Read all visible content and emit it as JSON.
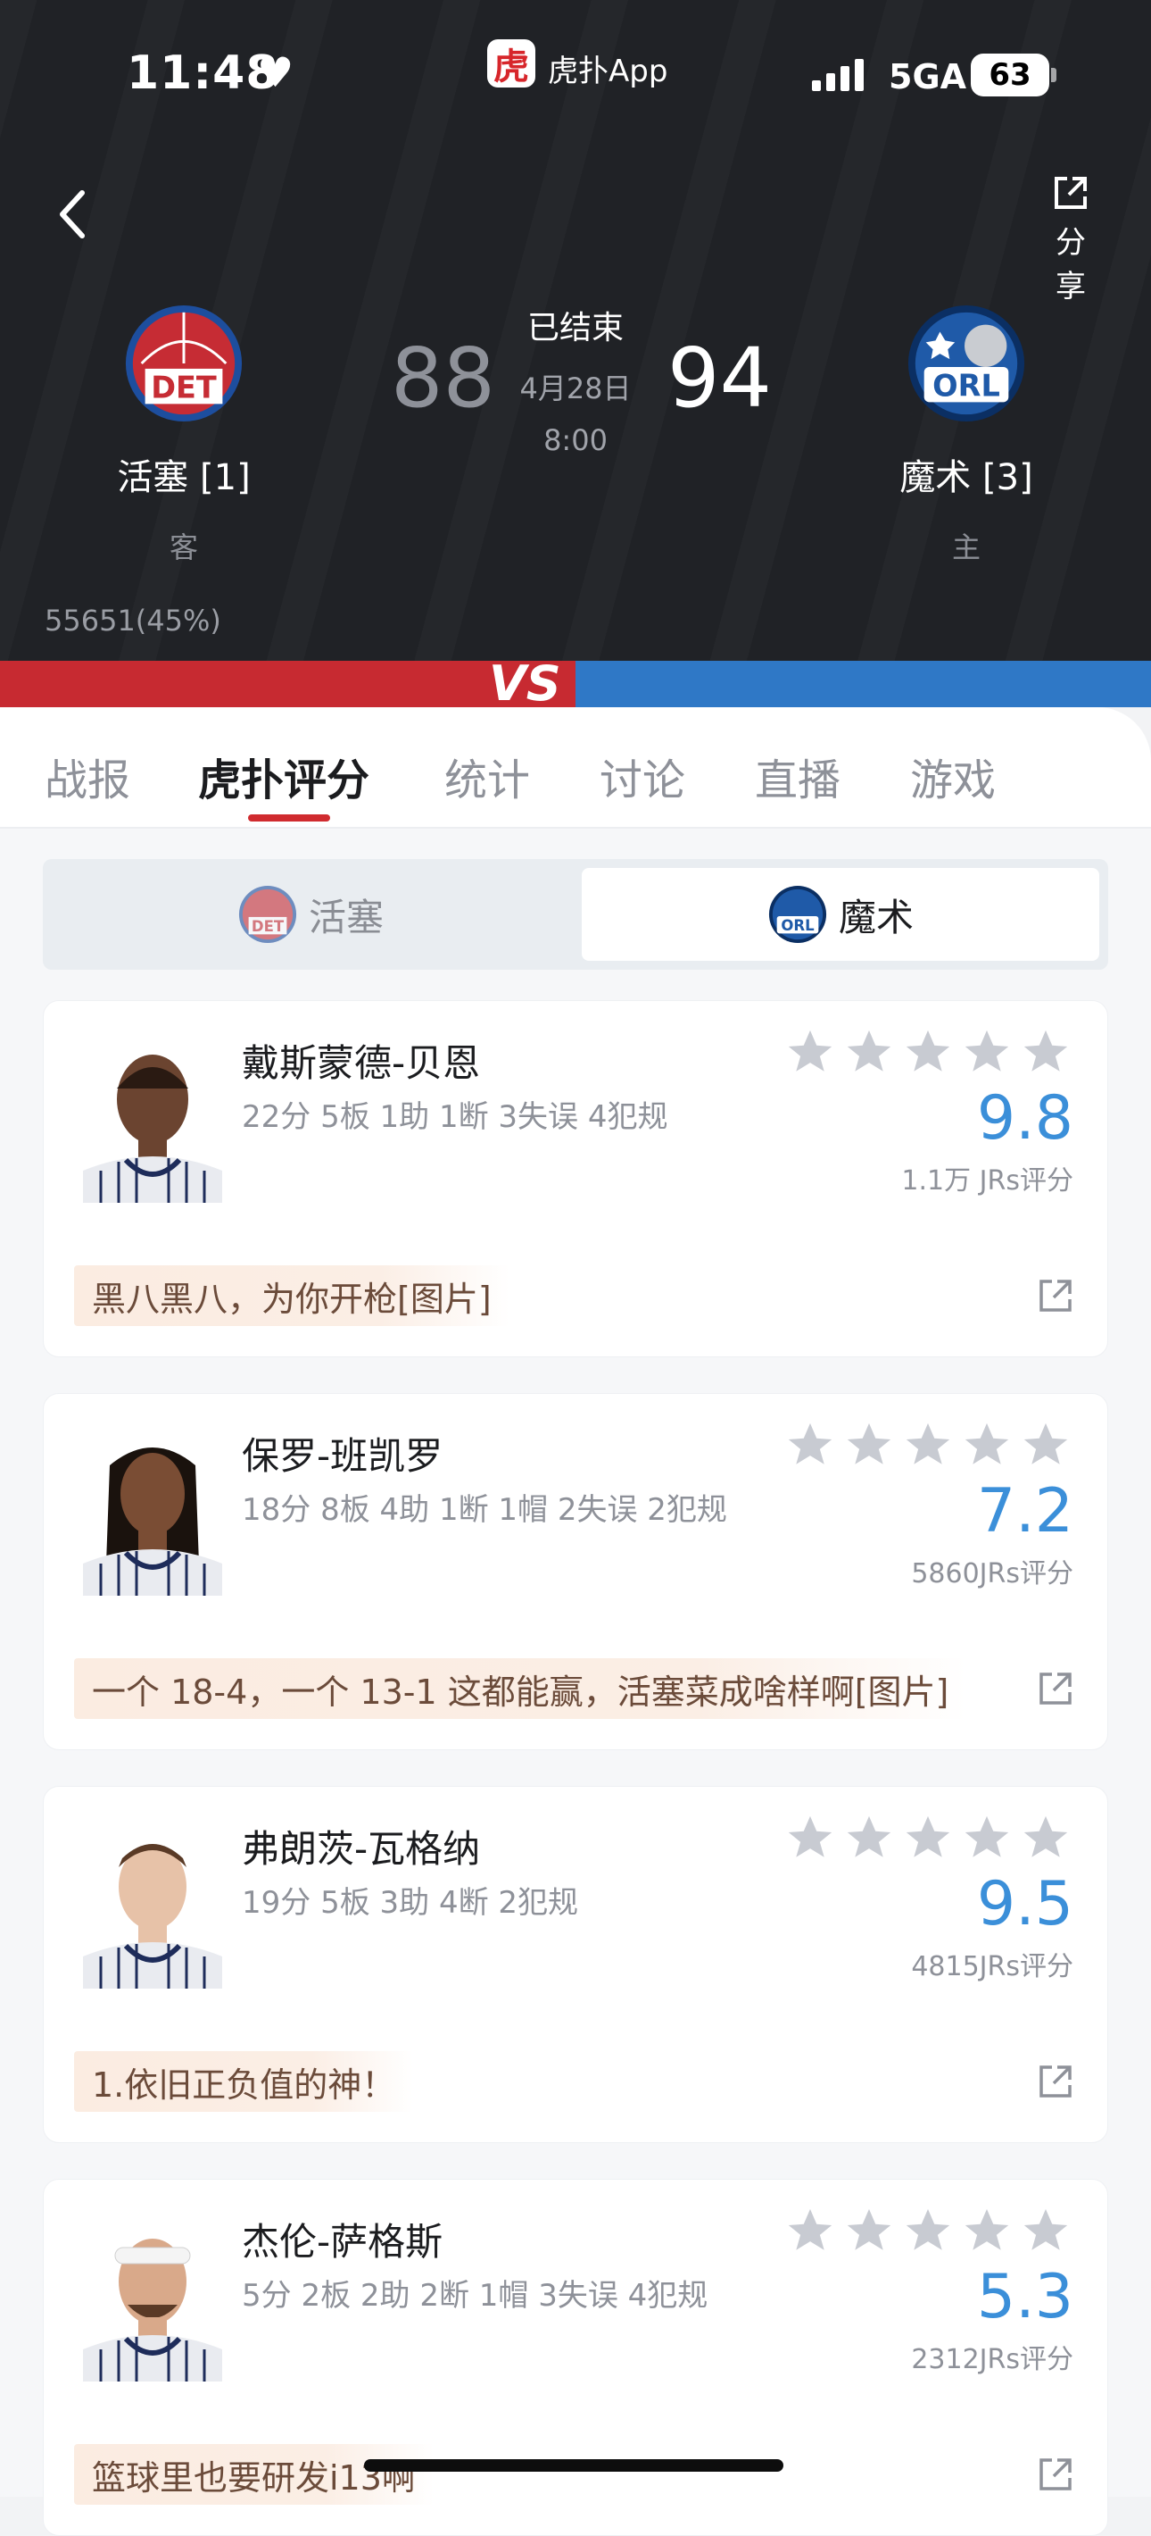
{
  "status_bar": {
    "time": "11:48",
    "app_name": "虎扑App",
    "app_logo_glyph": "虎",
    "network": "5GA",
    "battery": "63"
  },
  "header": {
    "share_label": "分享",
    "game_status": "已结束",
    "date": "4月28日",
    "time": "8:00",
    "away_team": {
      "name": "活塞 [1]",
      "side": "客",
      "score": "88",
      "abbr": "DET",
      "color": "#c62c34"
    },
    "home_team": {
      "name": "魔术 [3]",
      "side": "主",
      "score": "94",
      "abbr": "ORL",
      "color": "#1f5aa8"
    },
    "support_left": "55651(45%)",
    "vs": "VS"
  },
  "tabs": [
    "战报",
    "虎扑评分",
    "统计",
    "讨论",
    "直播",
    "游戏"
  ],
  "team_switch": {
    "away": "活塞",
    "home": "魔术"
  },
  "players": [
    {
      "name": "戴斯蒙德-贝恩",
      "stats": "22分 5板 1助 1断 3失误 4犯规",
      "rating": "9.8",
      "rating_count": "1.1万 JRs评分",
      "comment": "黑八黑八，为你开枪[图片]"
    },
    {
      "name": "保罗-班凯罗",
      "stats": "18分 8板 4助 1断 1帽 2失误 2犯规",
      "rating": "7.2",
      "rating_count": "5860JRs评分",
      "comment": "一个 18-4，一个 13-1 这都能赢，活塞菜成啥样啊[图片]"
    },
    {
      "name": "弗朗茨-瓦格纳",
      "stats": "19分 5板 3助 4断 2犯规",
      "rating": "9.5",
      "rating_count": "4815JRs评分",
      "comment": "1.依旧正负值的神！"
    },
    {
      "name": "杰伦-萨格斯",
      "stats": "5分 2板 2助 2断 1帽 3失误 4犯规",
      "rating": "5.3",
      "rating_count": "2312JRs评分",
      "comment": "篮球里也要研发i13啊"
    }
  ],
  "colors": {
    "header_bg": "#202226",
    "accent_red": "#d02b2f",
    "accent_blue": "#3b8fd9",
    "vs_red": "#c72a31",
    "vs_blue": "#2f78c6"
  }
}
